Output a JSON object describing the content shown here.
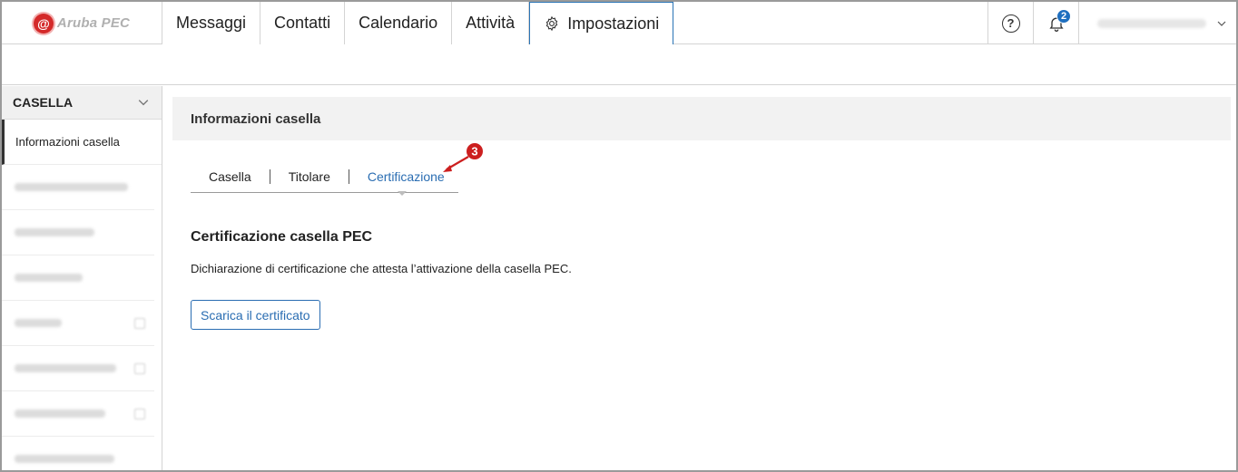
{
  "brand": {
    "logo_text": "Aruba PEC",
    "logo_symbol": "@",
    "accent": "#2a74b5",
    "logo_color": "#d42a2a"
  },
  "nav": {
    "tabs": [
      {
        "label": "Messaggi"
      },
      {
        "label": "Contatti"
      },
      {
        "label": "Calendario"
      },
      {
        "label": "Attività"
      },
      {
        "label": "Impostazioni",
        "icon": "gear-icon",
        "active": true
      }
    ]
  },
  "tools": {
    "help_symbol": "?",
    "notifications_count": "2"
  },
  "sidebar": {
    "header": "CASELLA",
    "active_item": "Informazioni casella",
    "blurred_items": 7
  },
  "main": {
    "section_title": "Informazioni casella",
    "subtabs": [
      {
        "label": "Casella"
      },
      {
        "label": "Titolare"
      },
      {
        "label": "Certificazione",
        "active": true
      }
    ],
    "marker_number": "3",
    "content_title": "Certificazione casella PEC",
    "content_description": "Dichiarazione di certificazione che attesta l’attivazione della casella PEC.",
    "download_button": "Scarica il certificato"
  }
}
